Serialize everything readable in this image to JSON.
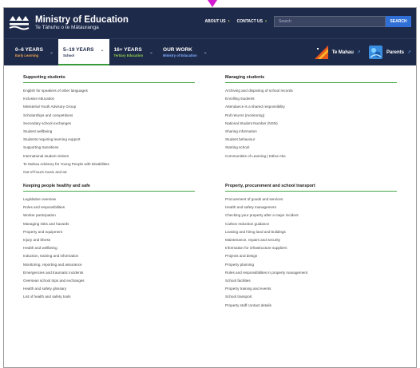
{
  "header": {
    "title": "Ministry of Education",
    "subtitle": "Te Tāhuhu o te Mātauranga",
    "about_label": "ABOUT US",
    "contact_label": "CONTACT US",
    "search_placeholder": "Search",
    "search_button": "SEARCH"
  },
  "nav": {
    "tabs": [
      {
        "label": "0–6 YEARS",
        "sub": "Early Learning"
      },
      {
        "label": "5–19 YEARS",
        "sub": "School"
      },
      {
        "label": "16+ YEARS",
        "sub": "Tertiary Education"
      },
      {
        "label": "OUR WORK",
        "sub": "Ministry of Education"
      }
    ],
    "te_mahau": "Te Mahau",
    "parents": "Parents"
  },
  "sections": {
    "supporting": {
      "title": "Supporting students",
      "items": [
        "English for speakers of other languages",
        "Inclusive education",
        "Ministerial Youth Advisory Group",
        "Scholarships and competitions",
        "Secondary school exchanges",
        "Student wellbeing",
        "Students requiring learning support",
        "Supporting transitions",
        "International student visitors",
        "Te Mahau Advisory for Young People with Disabilities",
        "Out-of-hours music and art"
      ]
    },
    "managing": {
      "title": "Managing students",
      "items": [
        "Archiving and disposing of school records",
        "Enrolling students",
        "Attendance is a shared responsibility",
        "Roll returns (monitoring)",
        "National Student Number (NSN)",
        "Sharing information",
        "Student behaviour",
        "Starting school",
        "Communities of Learning | Kāhui Ako"
      ]
    },
    "healthy": {
      "title": "Keeping people healthy and safe",
      "items": [
        "Legislative overview",
        "Roles and responsibilities",
        "Worker participation",
        "Managing risks and hazards",
        "Property and equipment",
        "Injury and illness",
        "Health and wellbeing",
        "Induction, training and information",
        "Monitoring, reporting and assurance",
        "Emergencies and traumatic incidents",
        "Overseas school trips and exchanges",
        "Health and safety glossary",
        "List of health and safety tools"
      ]
    },
    "property": {
      "title": "Property, procurement and school transport",
      "items": [
        "Procurement of goods and services",
        "Health and safety management",
        "Checking your property after a major incident",
        "Carbon reduction guidance",
        "Leasing and hiring land and buildings",
        "Maintenance, repairs and security",
        "Information for infrastructure suppliers",
        "Projects and design",
        "Property planning",
        "Roles and responsibilities in property management",
        "School facilities",
        "Property training and events",
        "School transport",
        "Property staff contact details"
      ]
    }
  }
}
